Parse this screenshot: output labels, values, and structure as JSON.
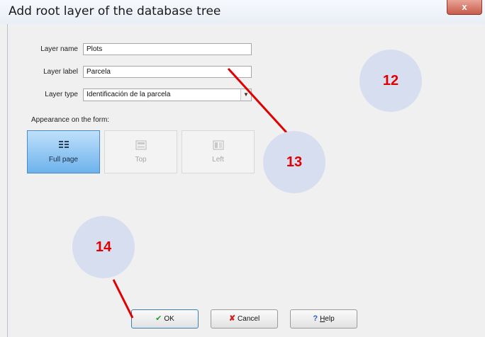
{
  "window": {
    "title": "Add root layer of the database tree",
    "close_glyph": "x"
  },
  "form": {
    "layer_name": {
      "label": "Layer name",
      "value": "Plots"
    },
    "layer_label": {
      "label": "Layer label",
      "value": "Parcela"
    },
    "layer_type": {
      "label": "Layer type",
      "value": "Identificación de la parcela"
    }
  },
  "appearance": {
    "label": "Appearance on the form:",
    "options": [
      {
        "label": "Full page",
        "icon": "full-page-icon",
        "selected": true
      },
      {
        "label": "Top",
        "icon": "top-layout-icon",
        "selected": false
      },
      {
        "label": "Left",
        "icon": "left-layout-icon",
        "selected": false
      }
    ]
  },
  "buttons": {
    "ok": "OK",
    "cancel": "Cancel",
    "help_underlined": "H",
    "help_rest": "elp"
  },
  "annotations": {
    "bubble_12": "12",
    "bubble_13": "13",
    "bubble_14": "14",
    "bubble_color": "#d7def0",
    "number_color": "#e00000",
    "line_color": "#e00000"
  }
}
